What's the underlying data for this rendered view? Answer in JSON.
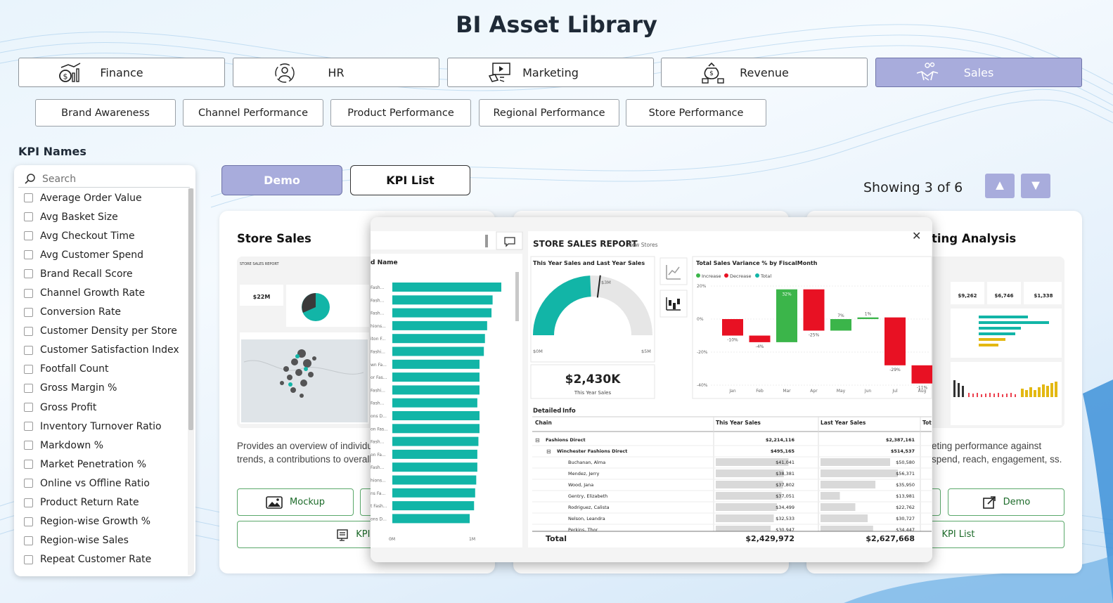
{
  "app": {
    "title": "BI Asset Library"
  },
  "categories": [
    {
      "label": "Finance",
      "icon": "finance-icon"
    },
    {
      "label": "HR",
      "icon": "hr-icon"
    },
    {
      "label": "Marketing",
      "icon": "marketing-icon"
    },
    {
      "label": "Revenue",
      "icon": "revenue-icon"
    },
    {
      "label": "Sales",
      "icon": "sales-handshake-icon",
      "active": true
    }
  ],
  "subcategories": [
    "Brand Awareness",
    "Channel Performance",
    "Product Performance",
    "Regional Performance",
    "Store Performance"
  ],
  "kpi": {
    "heading": "KPI Names",
    "search_placeholder": "Search",
    "items": [
      "Average Order Value",
      "Avg Basket Size",
      "Avg Checkout Time",
      "Avg Customer Spend",
      "Brand Recall Score",
      "Channel Growth Rate",
      "Conversion Rate",
      "Customer Density per Store",
      "Customer Satisfaction Index",
      "Footfall Count",
      "Gross Margin %",
      "Gross Profit",
      "Inventory Turnover Ratio",
      "Markdown %",
      "Market Penetration %",
      "Online vs Offline Ratio",
      "Product Return Rate",
      "Region-wise Growth %",
      "Region-wise Sales",
      "Repeat Customer Rate"
    ]
  },
  "view_toggle": {
    "demo": "Demo",
    "kpi_list": "KPI List"
  },
  "pager": {
    "showing": "Showing 3 of 6",
    "up": "▲",
    "down": "▼"
  },
  "cards": [
    {
      "title": "Store Sales",
      "desc": "Provides an overview of individu tracking sales volume, trends, a contributions to overall revenue",
      "btn_mockup": "Mockup",
      "btn_kpi": "KPI L",
      "thumb": {
        "report": "STORE SALES REPORT",
        "value": "$22M"
      }
    },
    {
      "title": "ting Analysis",
      "desc": "eting performance against spend, reach, engagement, ss.",
      "btn_demo": "Demo",
      "btn_kpi": "KPI List",
      "thumb": {
        "v1": "$9,262",
        "v2": "$6,746",
        "v3": "$1,338"
      }
    }
  ],
  "modal": {
    "close": "✕",
    "left_header": "d Name",
    "left_labels": [
      "Fash...",
      "Fash...",
      "Fash...",
      "hions...",
      "iton F...",
      "Fashi...",
      "wn Fa...",
      "or Fas...",
      "Fashi...",
      "Fash...",
      "ons D...",
      "on Fas...",
      "Fash...",
      "on Fa...",
      "Fash...",
      "hions...",
      "ns Fa...",
      "t Fash...",
      "ons D..."
    ],
    "left_values": [
      100,
      92,
      91,
      87,
      85,
      84,
      80,
      80,
      80,
      78,
      80,
      80,
      79,
      78,
      78,
      77,
      76,
      75,
      71
    ],
    "left_axis": [
      "0M",
      "1M"
    ],
    "report_title": "STORE SALES REPORT",
    "report_subtitle": "New Stores",
    "gauge": {
      "title": "This Year Sales and Last Year Sales",
      "target_label": "$3M",
      "min_label": "$0M",
      "max_label": "$5M",
      "value": "$2,430K",
      "caption": "This Year Sales",
      "fraction": 0.486
    },
    "waterfall": {
      "title": "Total Sales Variance % by FiscalMonth",
      "legend": [
        "Increase",
        "Decrease",
        "Total"
      ],
      "colors": {
        "increase": "#3bb54a",
        "decrease": "#e81123",
        "total": "#12b5a7"
      },
      "yticks": [
        "20%",
        "0%",
        "-20%",
        "-40%"
      ],
      "months": [
        "Jan",
        "Feb",
        "Mar",
        "Apr",
        "May",
        "Jun",
        "Jul",
        "Aug"
      ],
      "deltas": [
        -10,
        -4,
        32,
        -25,
        7,
        1,
        -29,
        -11
      ],
      "labels": [
        "-10%",
        "-4%",
        "32%",
        "-25%",
        "7%",
        "1%",
        "-29%",
        "-11%"
      ]
    },
    "detail": {
      "title": "Detailed",
      "title2": "Info",
      "columns": [
        "Chain",
        "This Year Sales",
        "Last Year Sales",
        "Tot"
      ],
      "rows": [
        {
          "name": "Fashions Direct",
          "ty": "$2,214,116",
          "ly": "$2,387,161",
          "level": 0,
          "expander": "⊟"
        },
        {
          "name": "Winchester Fashions Direct",
          "ty": "$495,165",
          "ly": "$514,537",
          "level": 1,
          "expander": "⊟"
        },
        {
          "name": "Buchanan, Alma",
          "ty": "$41,041",
          "ly": "$50,580",
          "level": 2
        },
        {
          "name": "Mendez, Jerry",
          "ty": "$38,381",
          "ly": "$56,371",
          "level": 2
        },
        {
          "name": "Wood, Jana",
          "ty": "$37,802",
          "ly": "$35,950",
          "level": 2
        },
        {
          "name": "Gentry, Elizabeth",
          "ty": "$37,051",
          "ly": "$13,981",
          "level": 2
        },
        {
          "name": "Rodriguez, Calista",
          "ty": "$34,499",
          "ly": "$22,762",
          "level": 2
        },
        {
          "name": "Nelson, Leandra",
          "ty": "$32,533",
          "ly": "$30,727",
          "level": 2
        },
        {
          "name": "Perkins, Thor",
          "ty": "$30,947",
          "ly": "$34,447",
          "level": 2
        }
      ],
      "ty_bars": [
        1,
        1,
        0.94,
        0.88,
        0.87,
        0.85,
        0.79,
        0.75,
        0.71
      ],
      "ly_bars": [
        1,
        1,
        0.9,
        1.0,
        0.71,
        0.25,
        0.45,
        0.61,
        0.68
      ],
      "total_label": "Total",
      "total_ty": "$2,429,972",
      "total_ly": "$2,627,668"
    }
  }
}
